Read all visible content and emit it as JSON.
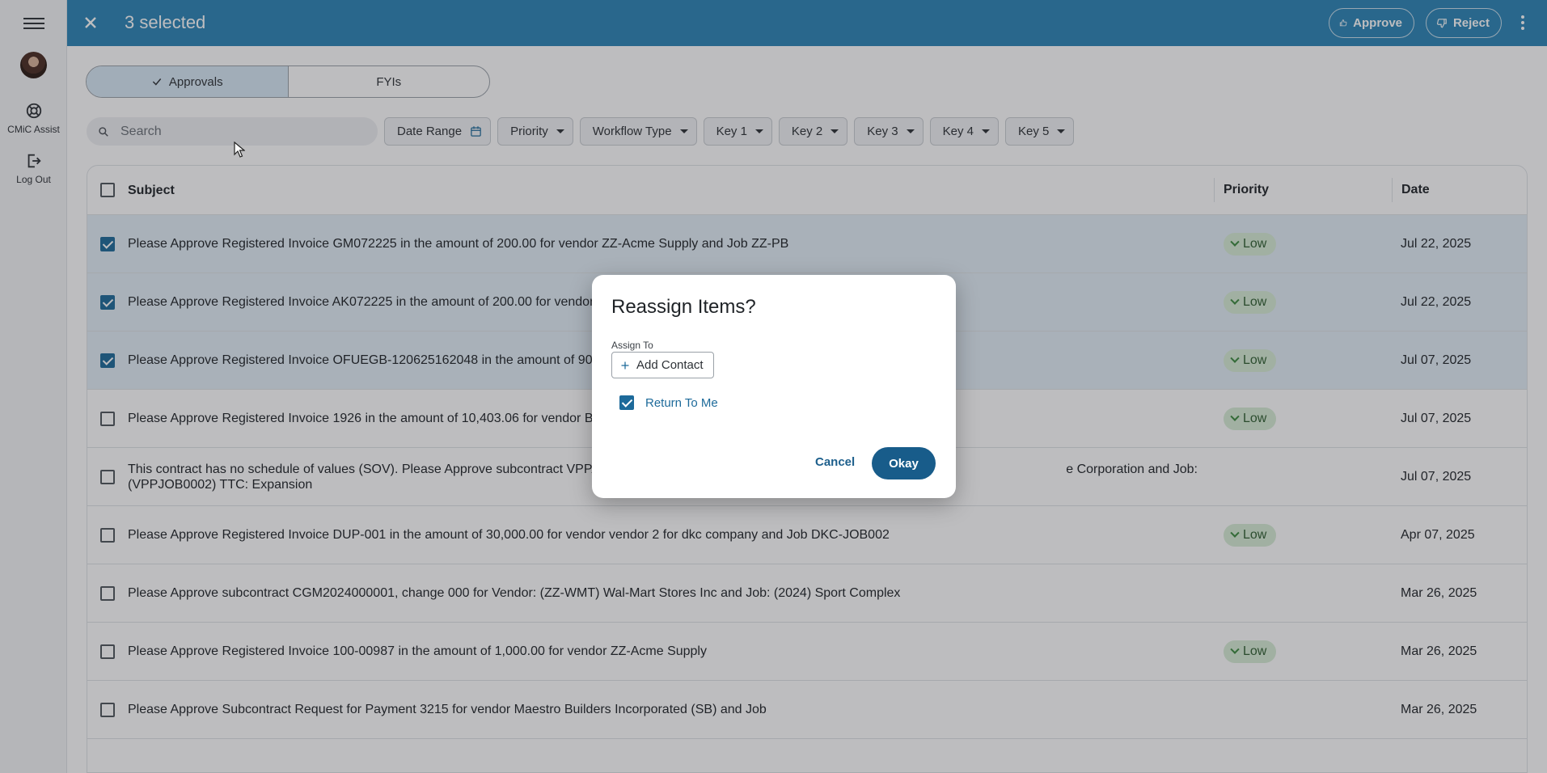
{
  "rail": {
    "assist_label": "CMiC Assist",
    "logout_label": "Log Out"
  },
  "topbar": {
    "selection_text": "3 selected",
    "approve_label": "Approve",
    "reject_label": "Reject"
  },
  "tabs": [
    {
      "label": "Approvals",
      "active": true
    },
    {
      "label": "FYIs",
      "active": false
    }
  ],
  "search": {
    "placeholder": "Search"
  },
  "filters": [
    {
      "label": "Date Range",
      "icon": "calendar-icon"
    },
    {
      "label": "Priority"
    },
    {
      "label": "Workflow Type"
    },
    {
      "label": "Key 1"
    },
    {
      "label": "Key 2"
    },
    {
      "label": "Key 3"
    },
    {
      "label": "Key 4"
    },
    {
      "label": "Key 5"
    }
  ],
  "table": {
    "headers": {
      "subject": "Subject",
      "priority": "Priority",
      "date": "Date"
    },
    "rows": [
      {
        "selected": true,
        "subject": "Please Approve Registered Invoice GM072225 in the amount of 200.00 for vendor ZZ-Acme Supply and Job ZZ-PB",
        "priority": "Low",
        "date": "Jul 22, 2025"
      },
      {
        "selected": true,
        "subject": "Please Approve Registered Invoice AK072225 in the amount of 200.00 for vendor",
        "priority": "Low",
        "date": "Jul 22, 2025"
      },
      {
        "selected": true,
        "subject": "Please Approve Registered Invoice OFUEGB-120625162048 in the amount of 90.3",
        "priority": "Low",
        "date": "Jul 07, 2025"
      },
      {
        "selected": false,
        "subject": "Please Approve Registered Invoice 1926 in the amount of 10,403.06 for vendor Be",
        "priority": "Low",
        "date": "Jul 07, 2025"
      },
      {
        "selected": false,
        "subject": "This contract has no schedule of values (SOV). Please Approve subcontract VPPA",
        "subject_tail": "e Corporation and Job:",
        "subject_line2": "(VPPJOB0002) TTC: Expansion",
        "priority": "",
        "date": "Jul 07, 2025"
      },
      {
        "selected": false,
        "subject": "Please Approve Registered Invoice DUP-001 in the amount of 30,000.00 for vendor vendor 2 for dkc company and Job DKC-JOB002",
        "priority": "Low",
        "date": "Apr 07, 2025"
      },
      {
        "selected": false,
        "subject": "Please Approve subcontract CGM2024000001, change 000 for Vendor: (ZZ-WMT) Wal-Mart Stores Inc and Job: (2024) Sport Complex",
        "priority": "",
        "date": "Mar 26, 2025"
      },
      {
        "selected": false,
        "subject": "Please Approve Registered Invoice 100-00987 in the amount of 1,000.00 for vendor ZZ-Acme Supply",
        "priority": "Low",
        "date": "Mar 26, 2025"
      },
      {
        "selected": false,
        "subject": "Please Approve Subcontract Request for Payment 3215 for vendor Maestro Builders Incorporated (SB) and Job",
        "priority": "",
        "date": "Mar 26, 2025"
      }
    ]
  },
  "dialog": {
    "title": "Reassign Items?",
    "assign_label": "Assign To",
    "add_contact_label": "Add Contact",
    "return_label": "Return To Me",
    "return_checked": true,
    "cancel_label": "Cancel",
    "ok_label": "Okay"
  },
  "colors": {
    "topbar": "#2b84b6",
    "primary": "#185c8a",
    "selected_row": "#e3eef6",
    "priority_low_bg": "#d7ecd6"
  }
}
